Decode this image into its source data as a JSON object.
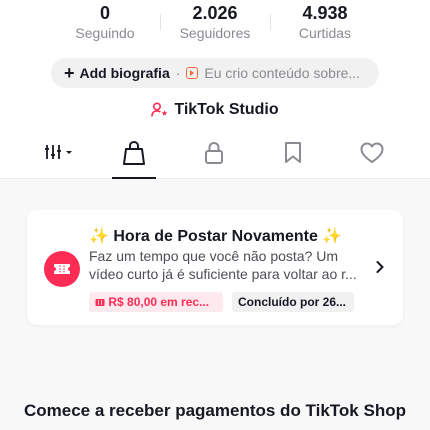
{
  "stats": [
    {
      "value": "0",
      "label": "Seguindo"
    },
    {
      "value": "2.026",
      "label": "Seguidores"
    },
    {
      "value": "4.938",
      "label": "Curtidas"
    }
  ],
  "bio": {
    "add_label": "Add biografia",
    "separator": "·",
    "hint": "Eu crio conteúdo sobre..."
  },
  "studio": {
    "label": "TikTok Studio"
  },
  "tabs": [
    "filters-icon",
    "shopping-bag-icon",
    "lock-icon",
    "bookmark-icon",
    "heart-icon"
  ],
  "card": {
    "title": "✨ Hora de Postar Novamente ✨",
    "description": "Faz um tempo que você não posta? Um vídeo curto já é suficiente para voltar ao r...",
    "reward_chip": "R$ 80,00 em rec...",
    "done_chip": "Concluído por 26..."
  },
  "footer": {
    "heading": "Comece a receber pagamentos do TikTok Shop"
  },
  "colors": {
    "accent": "#fe2c55",
    "text": "#161823",
    "muted": "#8a8b91"
  }
}
